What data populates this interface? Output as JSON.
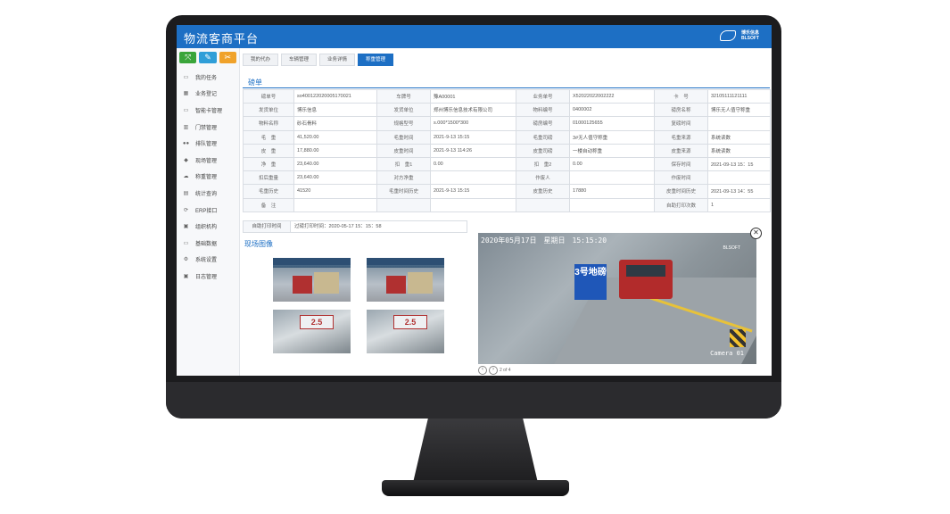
{
  "app": {
    "title": "物流客商平台",
    "logo_line1": "博乐信息",
    "logo_line2": "BLSOFT"
  },
  "quick_actions": [
    {
      "icon": "expand-icon",
      "glyph": "⤧"
    },
    {
      "icon": "pencil-icon",
      "glyph": "✎"
    },
    {
      "icon": "tools-icon",
      "glyph": "✂"
    }
  ],
  "sidebar": {
    "items": [
      {
        "label": "我的任务",
        "icon": "inbox-icon",
        "glyph": "▭"
      },
      {
        "label": "业务登记",
        "icon": "grid-icon",
        "glyph": "▦"
      },
      {
        "label": "智能卡管理",
        "icon": "card-icon",
        "glyph": "▭"
      },
      {
        "label": "门禁管理",
        "icon": "gate-icon",
        "glyph": "▥"
      },
      {
        "label": "排队管理",
        "icon": "queue-icon",
        "glyph": "●●"
      },
      {
        "label": "现场管理",
        "icon": "truck-icon",
        "glyph": "◆"
      },
      {
        "label": "称重管理",
        "icon": "cloud-icon",
        "glyph": "☁"
      },
      {
        "label": "统计查询",
        "icon": "stats-icon",
        "glyph": "▤"
      },
      {
        "label": "ERP接口",
        "icon": "sync-icon",
        "glyph": "⟳"
      },
      {
        "label": "组织机构",
        "icon": "org-icon",
        "glyph": "▣"
      },
      {
        "label": "基础数据",
        "icon": "database-icon",
        "glyph": "▭"
      },
      {
        "label": "系统设置",
        "icon": "settings-icon",
        "glyph": "⚙"
      },
      {
        "label": "日志管理",
        "icon": "log-icon",
        "glyph": "▣"
      }
    ]
  },
  "tabs": [
    {
      "label": "我的代办",
      "active": false
    },
    {
      "label": "车辆管理",
      "active": false
    },
    {
      "label": "业务详情",
      "active": false
    },
    {
      "label": "称重管理",
      "active": true
    }
  ],
  "pound": {
    "title": "磅单",
    "rows": [
      [
        "磅单号",
        "so400122020005170021",
        "车牌号",
        "豫A00001",
        "业务单号",
        "X52022022002222",
        "卡　号",
        "32105111121111"
      ],
      [
        "发货单位",
        "博乐信息",
        "发货单位",
        "郑州博乐信息技术有限公司",
        "物料编号",
        "0400002",
        "磅房名称",
        "博乐无人值守称重"
      ],
      [
        "物料名称",
        "砂石骨料",
        "规格型号",
        "s.000*1500*300",
        "磅房编号",
        "01000125655",
        "复磅时间",
        ""
      ],
      [
        "毛　重",
        "41,520.00",
        "毛重时间",
        "2021-9-13 15:15",
        "毛重司磅",
        "3#无人值守称重",
        "毛重来源",
        "系统读数"
      ],
      [
        "皮　重",
        "17,880.00",
        "皮重时间",
        "2021-9-13 114:26",
        "皮重司磅",
        "一楼自动称重",
        "皮重来源",
        "系统读数"
      ],
      [
        "净　重",
        "23,640.00",
        "扣　重1",
        "0.00",
        "扣　重2",
        "0.00",
        "保存时间",
        "2021-09-13 15：15"
      ],
      [
        "扣后重量",
        "23,640.00",
        "对方净重",
        "",
        "作废人",
        "",
        "作废时间",
        ""
      ],
      [
        "毛重历史",
        "41520",
        "毛重时间历史",
        "2021-9-13 15:15",
        "皮重历史",
        "17880",
        "皮重时间历史",
        "2021-09-13 14：55"
      ],
      [
        "备　注",
        "",
        "",
        "",
        "",
        "",
        "自助打印次数",
        "1"
      ]
    ],
    "print_label": "自助打印时间",
    "print_value": "过磅打印时间：2020-05-17 15：15：58"
  },
  "scene": {
    "title": "现场图像",
    "camera_timestamp": "2020年05月17日　星期日　15:15:20",
    "camera_label": "Camera 01",
    "camera_logo": "BLSOFT",
    "sign_text": "3号地磅",
    "thumb_plate": "2.5",
    "pager_text": "2 of 4"
  }
}
